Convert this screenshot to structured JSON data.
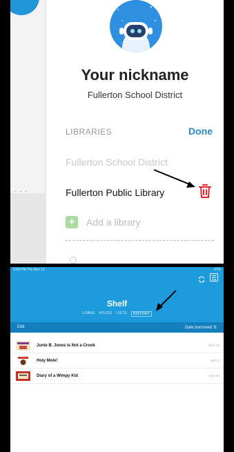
{
  "profile": {
    "nickname": "Your nickname",
    "district": "Fullerton School District"
  },
  "libraries": {
    "heading": "LIBRARIES",
    "done_label": "Done",
    "items": [
      {
        "name": "Fullerton School District"
      },
      {
        "name": "Fullerton Public Library"
      }
    ],
    "add_label": "Add a library"
  },
  "shelf": {
    "status_left": "3:58 PM  Thu Nov 12",
    "status_right": "47%",
    "title": "Shelf",
    "tabs": [
      {
        "label": "LOANS"
      },
      {
        "label": "HOLDS"
      },
      {
        "label": "LISTS"
      },
      {
        "label": "HISTORY"
      }
    ],
    "active_tab": "HISTORY",
    "edit_label": "Edit",
    "sort_label": "Date borrowed ⇅",
    "items": [
      {
        "title": "Junie B. Jones Is Not a Crook",
        "date": "NOV 12"
      },
      {
        "title": "Holy Mole!",
        "date": "NOV 3"
      },
      {
        "title": "Diary of a Wimpy Kid",
        "date": "AUG 24"
      }
    ]
  },
  "colors": {
    "accent_blue": "#1d9bdc",
    "done_blue": "#2e86c9",
    "trash_red": "#e0242a",
    "add_green": "#a8dba0"
  }
}
